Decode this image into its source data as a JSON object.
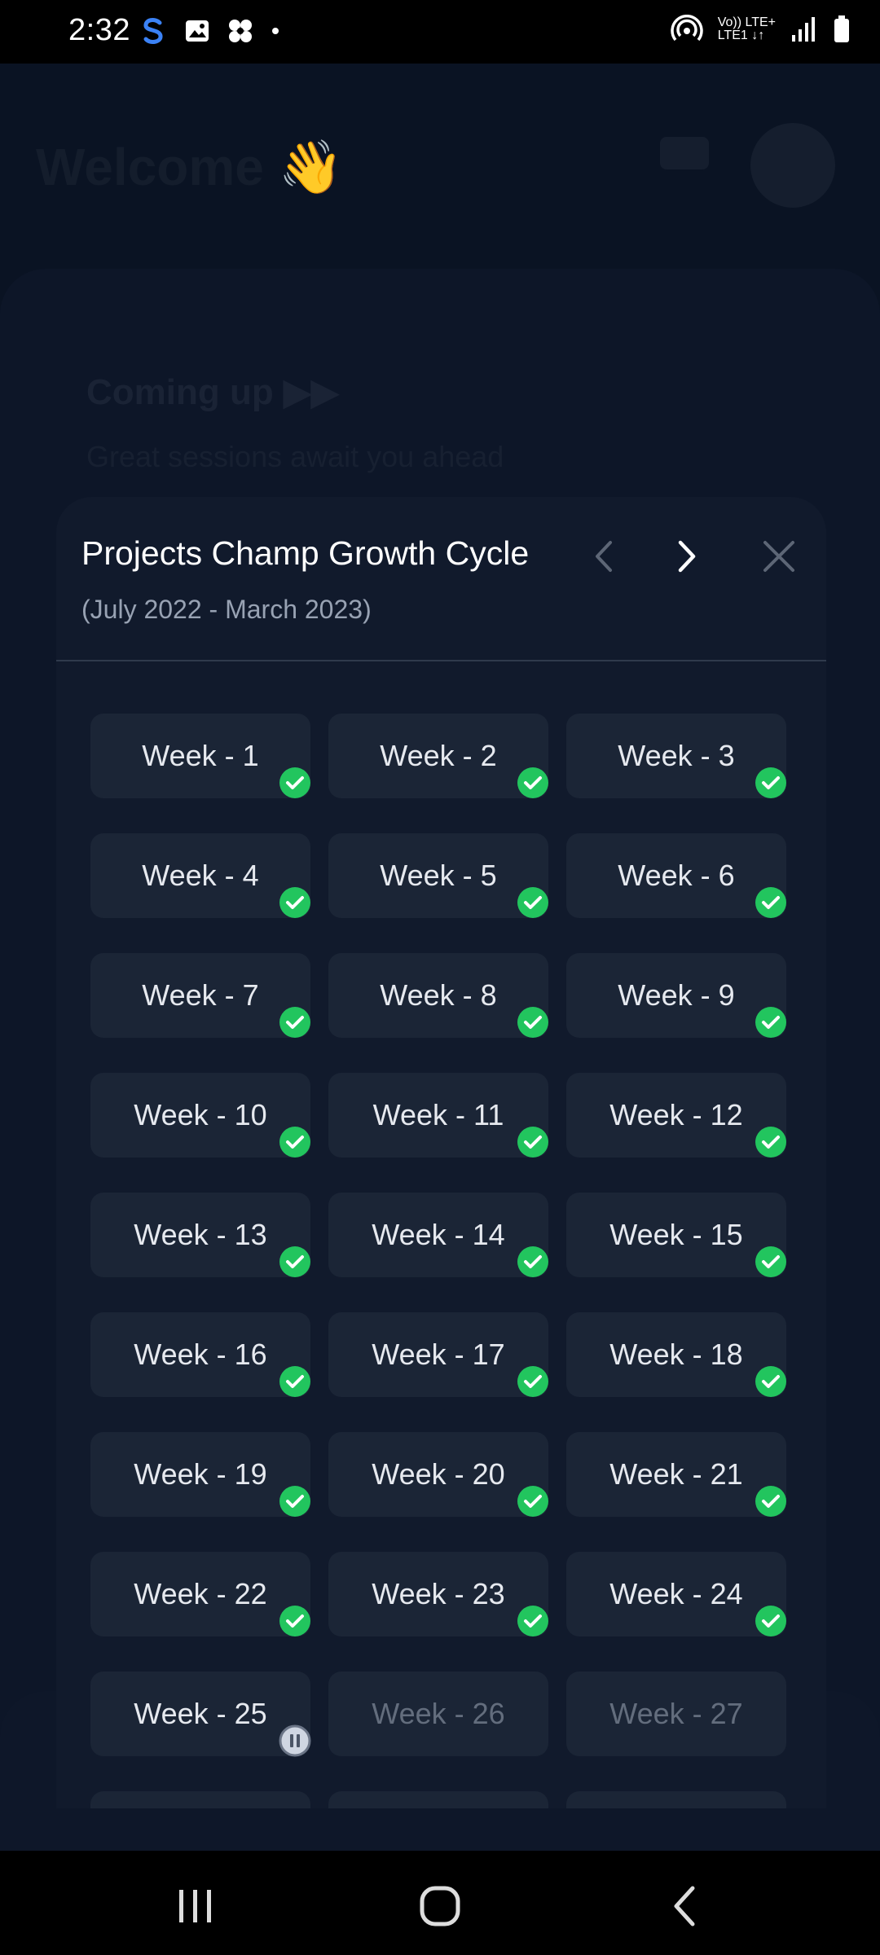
{
  "status_bar": {
    "time": "2:32",
    "lte_top": "Vo)) LTE+",
    "lte_bottom": "LTE1 ↓↑"
  },
  "background": {
    "title": "Welcome 👋",
    "coming_up": "Coming up ▶▶",
    "coming_up_sub": "Great sessions await you ahead"
  },
  "modal": {
    "title": "Projects Champ Growth Cycle",
    "subtitle": "(July 2022 - March 2023)",
    "weeks": [
      {
        "label": "Week - 1",
        "status": "done"
      },
      {
        "label": "Week - 2",
        "status": "done"
      },
      {
        "label": "Week - 3",
        "status": "done"
      },
      {
        "label": "Week - 4",
        "status": "done"
      },
      {
        "label": "Week - 5",
        "status": "done"
      },
      {
        "label": "Week - 6",
        "status": "done"
      },
      {
        "label": "Week - 7",
        "status": "done"
      },
      {
        "label": "Week - 8",
        "status": "done"
      },
      {
        "label": "Week - 9",
        "status": "done"
      },
      {
        "label": "Week - 10",
        "status": "done"
      },
      {
        "label": "Week - 11",
        "status": "done"
      },
      {
        "label": "Week - 12",
        "status": "done"
      },
      {
        "label": "Week - 13",
        "status": "done"
      },
      {
        "label": "Week - 14",
        "status": "done"
      },
      {
        "label": "Week - 15",
        "status": "done"
      },
      {
        "label": "Week - 16",
        "status": "done"
      },
      {
        "label": "Week - 17",
        "status": "done"
      },
      {
        "label": "Week - 18",
        "status": "done"
      },
      {
        "label": "Week - 19",
        "status": "done"
      },
      {
        "label": "Week - 20",
        "status": "done"
      },
      {
        "label": "Week - 21",
        "status": "done"
      },
      {
        "label": "Week - 22",
        "status": "done"
      },
      {
        "label": "Week - 23",
        "status": "done"
      },
      {
        "label": "Week - 24",
        "status": "done"
      },
      {
        "label": "Week - 25",
        "status": "paused"
      },
      {
        "label": "Week - 26",
        "status": "future"
      },
      {
        "label": "Week - 27",
        "status": "future"
      },
      {
        "label": "",
        "status": "future"
      },
      {
        "label": "",
        "status": "future"
      },
      {
        "label": "",
        "status": "future"
      }
    ]
  },
  "colors": {
    "accent_green": "#22c55e",
    "pause_gray": "#cfd6e2"
  }
}
